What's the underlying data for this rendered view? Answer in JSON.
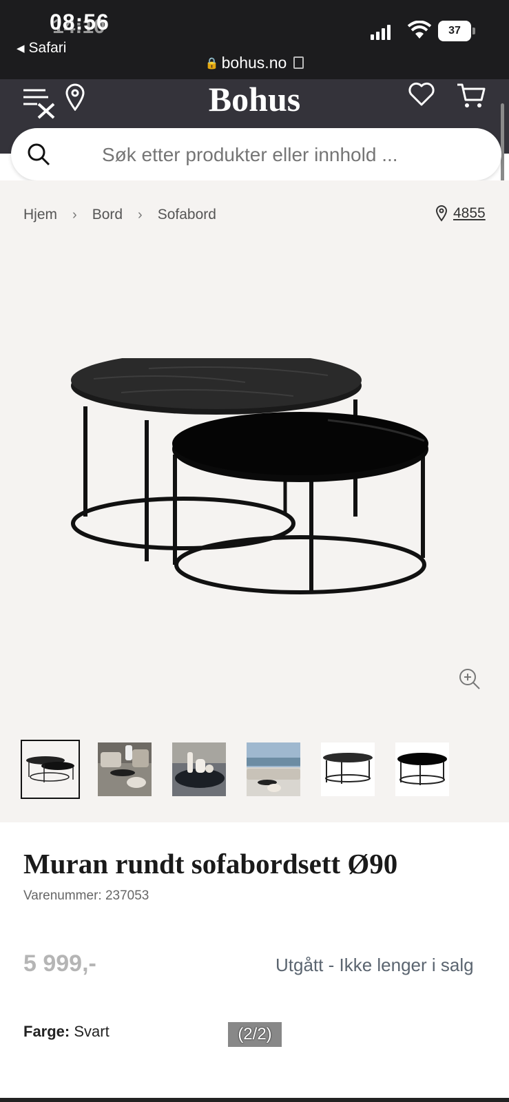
{
  "status_bar": {
    "time": "08:56",
    "time_overlay": "14:10",
    "back_app": "Safari",
    "battery": "37",
    "url": "bohus.no"
  },
  "header": {
    "logo": "Bohus"
  },
  "search": {
    "placeholder": "Søk etter produkter eller innhold ..."
  },
  "breadcrumb": [
    "Hjem",
    "Bord",
    "Sofabord"
  ],
  "store_number": "4855",
  "product": {
    "title": "Muran rundt sofabordsett Ø90",
    "sku": "Varenummer: 237053",
    "price": "5 999,-",
    "status": "Utgått - Ikke lenger i salg",
    "color_label": "Farge:",
    "color_value": "Svart",
    "image_counter": "(2/2)"
  },
  "colors": {
    "header_bg": "#34333a",
    "status_bg": "#1c1c1e",
    "product_bg": "#f5f3f1",
    "price_grey": "#b5b5b5"
  },
  "icons": [
    "menu-close-icon",
    "location-pin-icon",
    "heart-icon",
    "cart-icon",
    "search-icon",
    "zoom-in-icon",
    "lock-icon",
    "copy-icon"
  ]
}
